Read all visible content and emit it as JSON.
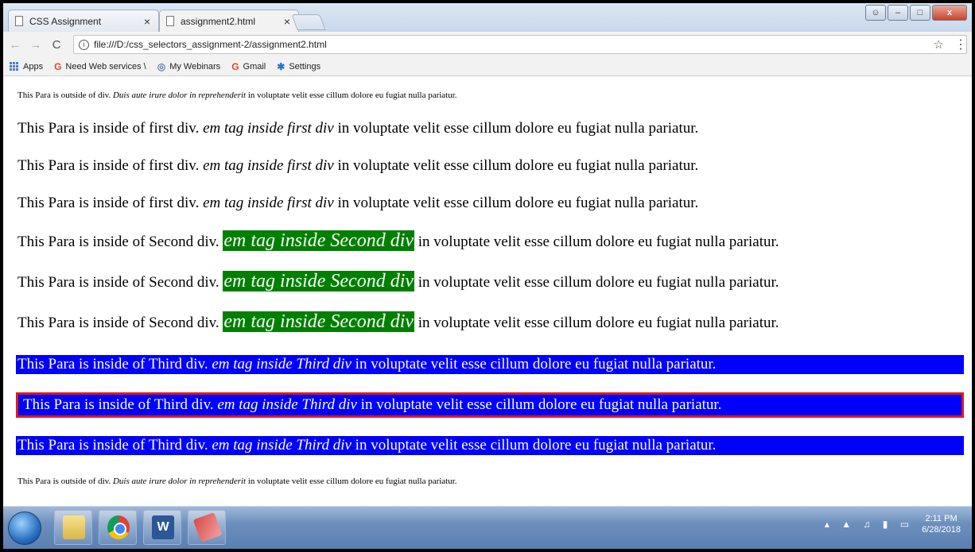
{
  "browser": {
    "tabs": [
      {
        "title": "CSS Assignment",
        "close": "×"
      },
      {
        "title": "assignment2.html",
        "close": "×"
      }
    ],
    "window_controls": {
      "minimize": "–",
      "maximize": "□",
      "close": "x"
    },
    "nav": {
      "back": "←",
      "forward": "→",
      "reload": "C"
    },
    "address": "file:///D:/css_selectors_assignment-2/assignment2.html",
    "bookmarks": [
      {
        "label": "Apps"
      },
      {
        "label": "Need Web services \\",
        "icon": "G"
      },
      {
        "label": "My Webinars",
        "icon": "◎"
      },
      {
        "label": "Gmail",
        "icon": "G"
      },
      {
        "label": "Settings",
        "icon": "✱"
      }
    ]
  },
  "page": {
    "outside_para": {
      "text": "This Para is outside of div. ",
      "em": "Duis aute irure dolor in reprehenderit",
      "rest": " in voluptate velit esse cillum dolore eu fugiat nulla pariatur."
    },
    "first_div_para": {
      "text": "This Para is inside of first div. ",
      "em": "em tag inside first div",
      "rest": " in voluptate velit esse cillum dolore eu fugiat nulla pariatur."
    },
    "second_div_para": {
      "text": "This Para is inside of Second div. ",
      "em": "em tag inside Second div",
      "rest": " in voluptate velit esse cillum dolore eu fugiat nulla pariatur."
    },
    "third_div_para": {
      "text": "This Para is inside of Third div. ",
      "em": "em tag inside Third div",
      "rest": " in voluptate velit esse cillum dolore eu fugiat nulla pariatur."
    },
    "colors": {
      "green_em_bg": "#008000",
      "third_bg": "#0000ff",
      "highlight_border": "#dc1a1a"
    }
  },
  "taskbar": {
    "clock_time": "2:11 PM",
    "clock_date": "6/28/2018",
    "apps": [
      "start",
      "explorer",
      "chrome",
      "word",
      "eraser"
    ]
  }
}
